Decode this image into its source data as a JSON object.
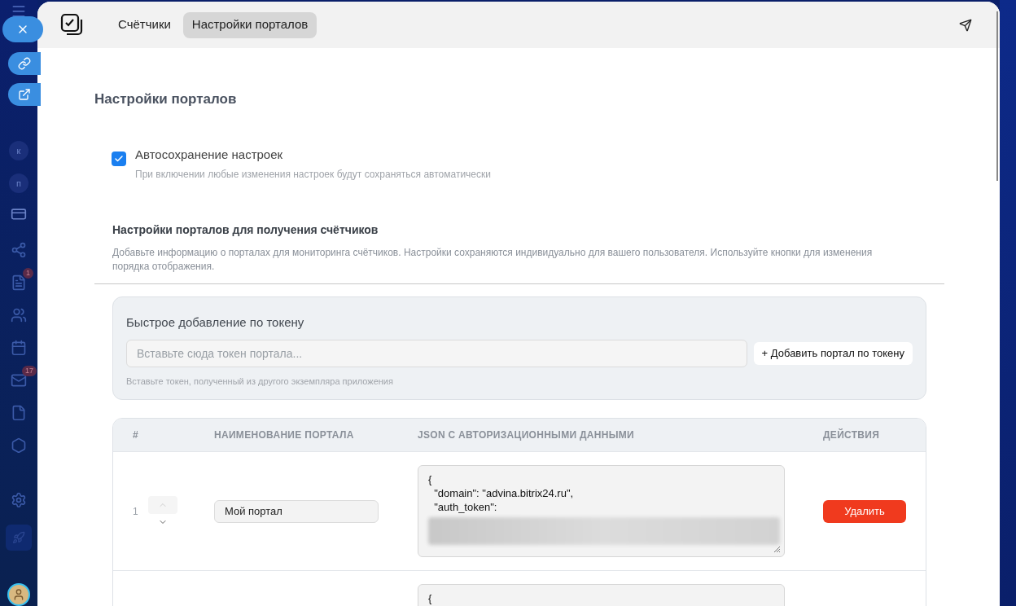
{
  "sidebar": {
    "letters": [
      "к",
      "п"
    ],
    "badges": [
      "1",
      "17"
    ]
  },
  "header": {
    "tabs": [
      {
        "label": "Счётчики",
        "selected": false
      },
      {
        "label": "Настройки порталов",
        "selected": true
      }
    ]
  },
  "page": {
    "title": "Настройки порталов",
    "autosave": {
      "label": "Автосохранение настроек",
      "hint": "При включении любые изменения настроек будут сохраняться автоматически",
      "checked": true
    },
    "section": {
      "title": "Настройки порталов для получения счётчиков",
      "description": "Добавьте информацию о порталах для мониторинга счётчиков. Настройки сохраняются индивидуально для вашего пользователя. Используйте кнопки для изменения порядка отображения."
    },
    "token": {
      "title": "Быстрое добавление по токену",
      "placeholder": "Вставьте сюда токен портала...",
      "button": "+ Добавить портал по токену",
      "hint": "Вставьте токен, полученный из другого экземпляра приложения"
    },
    "table": {
      "columns": [
        "#",
        "НАИМЕНОВАНИЕ ПОРТАЛА",
        "JSON С АВТОРИЗАЦИОННЫМИ ДАННЫМИ",
        "ДЕЙСТВИЯ"
      ],
      "rows": [
        {
          "number": "1",
          "name": "Мой портал",
          "json_lines": [
            "{",
            "  \"domain\": \"advina.bitrix24.ru\",",
            "  \"auth_token\":"
          ],
          "redacted": true,
          "action": "Удалить"
        },
        {
          "json_lines": [
            "{"
          ],
          "redacted": false
        }
      ]
    }
  }
}
